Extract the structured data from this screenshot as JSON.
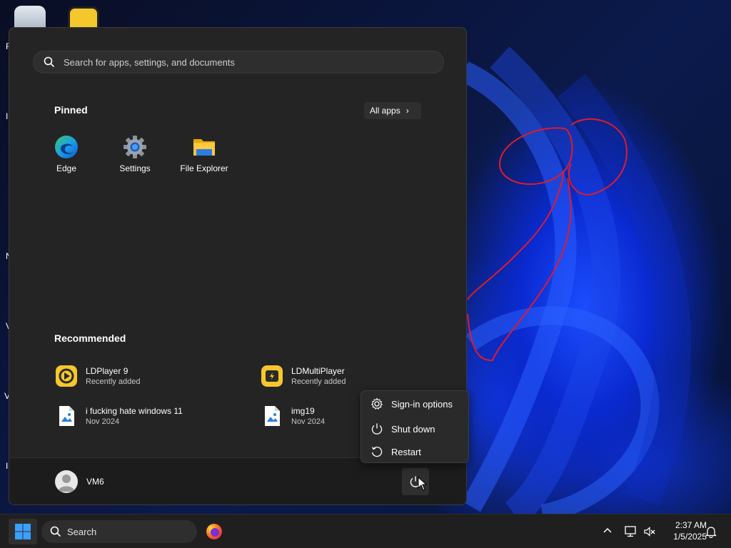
{
  "desktop": {
    "edge_letters": [
      "R",
      "I",
      "N",
      "V",
      "V",
      "I"
    ],
    "icons": [
      "recycle-bin-icon",
      "ldplayer-desktop-icon"
    ]
  },
  "start_menu": {
    "search_placeholder": "Search for apps, settings, and documents",
    "pinned_title": "Pinned",
    "all_apps_label": "All apps",
    "pinned": [
      {
        "label": "Edge",
        "icon": "edge-icon"
      },
      {
        "label": "Settings",
        "icon": "settings-gear-icon"
      },
      {
        "label": "File Explorer",
        "icon": "folder-icon"
      }
    ],
    "recommended_title": "Recommended",
    "recommended": [
      {
        "name": "LDPlayer 9",
        "sub": "Recently added",
        "icon": "ldplayer-icon"
      },
      {
        "name": "LDMultiPlayer",
        "sub": "Recently added",
        "icon": "ldmultiplayer-icon"
      },
      {
        "name": "i fucking hate windows 11",
        "sub": "Nov 2024",
        "icon": "image-file-icon"
      },
      {
        "name": "img19",
        "sub": "Nov 2024",
        "icon": "image-file-icon"
      }
    ],
    "user_name": "VM6",
    "power_menu": {
      "items": [
        "Sign-in options",
        "Shut down",
        "Restart"
      ]
    }
  },
  "taskbar": {
    "search_placeholder": "Search",
    "time": "2:37 AM",
    "date": "1/5/2025"
  },
  "colors": {
    "menu_bg": "#242424",
    "accent_blue": "#1b4dff",
    "ldplayer_yellow": "#f5c72c"
  }
}
